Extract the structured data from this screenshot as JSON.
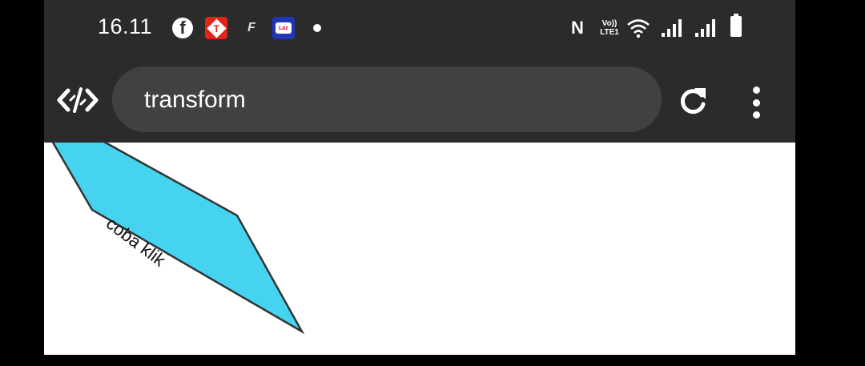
{
  "status_bar": {
    "time": "16.11",
    "lte_top": "Vo))",
    "lte_bottom": "LTE1"
  },
  "toolbar": {
    "url_text": "transform"
  },
  "content": {
    "button_label": "coba klik",
    "button_color": "#45d3f0"
  }
}
